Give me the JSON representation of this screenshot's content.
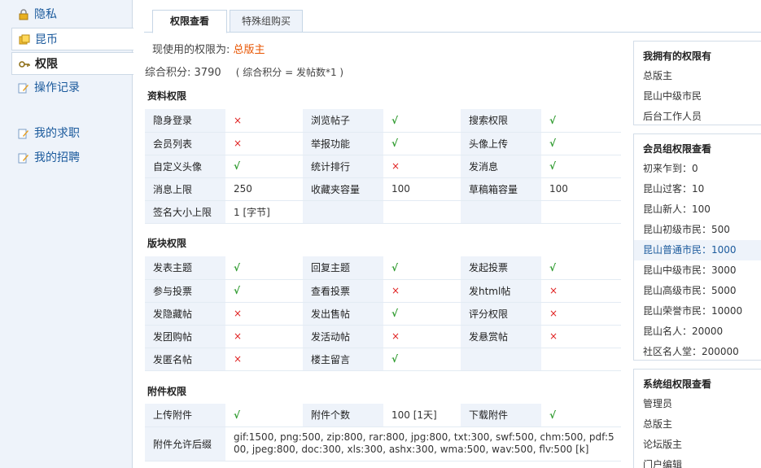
{
  "sidebar": {
    "items": [
      {
        "label": "隐私"
      },
      {
        "label": "昆币"
      },
      {
        "label": "权限"
      },
      {
        "label": "操作记录"
      },
      {
        "label": "我的求职"
      },
      {
        "label": "我的招聘"
      }
    ]
  },
  "tabs": [
    {
      "label": "权限查看"
    },
    {
      "label": "特殊组购买"
    }
  ],
  "current": {
    "prefix": "现使用的权限为:",
    "role": "总版主"
  },
  "score": {
    "label": "综合积分:",
    "value": "3790",
    "formula": "( 综合积分 = 发帖数*1 )"
  },
  "sections": {
    "profile": "资料权限",
    "board": "版块权限",
    "attach": "附件权限"
  },
  "profile_rows": [
    [
      "隐身登录",
      "×",
      "浏览帖子",
      "√",
      "搜索权限",
      "√"
    ],
    [
      "会员列表",
      "×",
      "举报功能",
      "√",
      "头像上传",
      "√"
    ],
    [
      "自定义头像",
      "√",
      "统计排行",
      "×",
      "发消息",
      "√"
    ],
    [
      "消息上限",
      "250",
      "收藏夹容量",
      "100",
      "草稿箱容量",
      "100"
    ],
    [
      "签名大小上限",
      "1 [字节]",
      "",
      "",
      "",
      ""
    ]
  ],
  "board_rows": [
    [
      "发表主题",
      "√",
      "回复主题",
      "√",
      "发起投票",
      "√"
    ],
    [
      "参与投票",
      "√",
      "查看投票",
      "×",
      "发html帖",
      "×"
    ],
    [
      "发隐藏帖",
      "×",
      "发出售帖",
      "√",
      "评分权限",
      "×"
    ],
    [
      "发团购帖",
      "×",
      "发活动帖",
      "×",
      "发悬赏帖",
      "×"
    ],
    [
      "发匿名帖",
      "×",
      "楼主留言",
      "√",
      "",
      ""
    ]
  ],
  "attach_rows": [
    [
      "上传附件",
      "√",
      "附件个数",
      "100 [1天]",
      "下载附件",
      "√"
    ]
  ],
  "attach_ext": {
    "label": "附件允许后缀",
    "value": "gif:1500, png:500, zip:800, rar:800, jpg:800, txt:300, swf:500, chm:500, pdf:500, jpeg:800, doc:300, xls:300, ashx:300, wma:500, wav:500, flv:500 [k]"
  },
  "right": {
    "owned": {
      "title": "我拥有的权限有",
      "items": [
        "总版主",
        "昆山中级市民",
        "后台工作人员"
      ]
    },
    "member": {
      "title": "会员组权限查看",
      "items": [
        "初来乍到：0",
        "昆山过客：10",
        "昆山新人：100",
        "昆山初级市民：500",
        "昆山普通市民：1000",
        "昆山中级市民：3000",
        "昆山高级市民：5000",
        "昆山荣誉市民：10000",
        "昆山名人：20000",
        "社区名人堂：200000"
      ]
    },
    "system": {
      "title": "系统组权限查看",
      "items": [
        "管理员",
        "总版主",
        "论坛版主",
        "门户编辑"
      ]
    }
  }
}
